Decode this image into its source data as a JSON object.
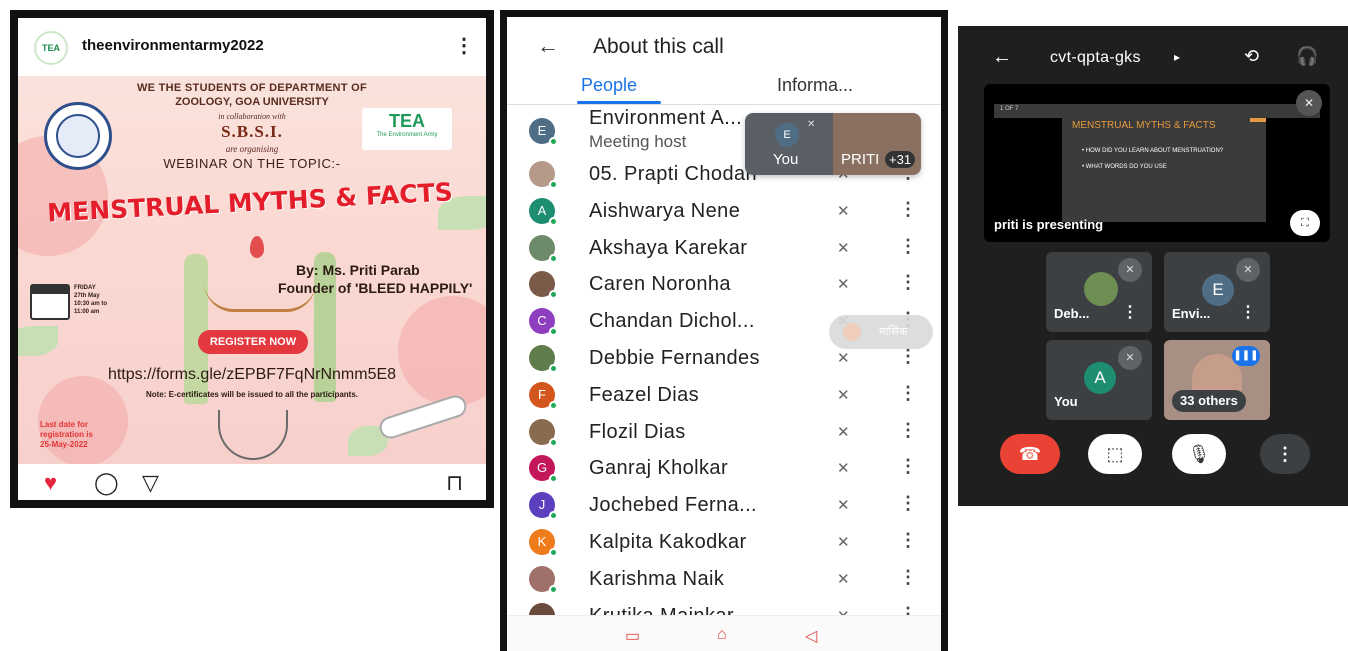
{
  "instagram": {
    "username": "theenvironmentarmy2022",
    "avatar_text": "TEA",
    "more_icon": "⋮",
    "poster": {
      "line1": "WE THE STUDENTS OF DEPARTMENT OF",
      "line2": "ZOOLOGY, GOA UNIVERSITY",
      "collab": "in collaboration with",
      "sbsi": "S.B.S.I.",
      "organising": "are organising",
      "topic": "WEBINAR ON THE TOPIC:-",
      "title": "MENSTRUAL MYTHS & FACTS",
      "tea_logo": "TEA",
      "tea_caption": "The Environment Army",
      "speaker": "By: Ms. Priti Parab",
      "founder": "Founder of  'BLEED HAPPILY'",
      "date_lines": [
        "FRIDAY",
        "27th May",
        "10:30 am to",
        "11:00 am"
      ],
      "register": "REGISTER NOW",
      "url": "https://forms.gle/zEPBF7FqNrNnmm5E8",
      "note": "Note: E-certificates will be issued to all the participants.",
      "last_date": [
        "Last date for",
        "registration is",
        "25-May-2022"
      ]
    }
  },
  "call": {
    "title": "About this call",
    "back_icon": "←",
    "tabs": [
      "People",
      "Informa..."
    ],
    "host": {
      "name": "Environment A...",
      "role": "Meeting host",
      "initial": "E",
      "color": "#4f6e86"
    },
    "pip": {
      "you_initial": "E",
      "you_label": "You",
      "other_label": "PRITI",
      "count": "+31"
    },
    "toast_text": "मासिक",
    "participants": [
      {
        "name": "05. Prapti Chodan",
        "initial": "",
        "color": "#b59a8a",
        "photo": true
      },
      {
        "name": "Aishwarya Nene",
        "initial": "A",
        "color": "#1e8e72"
      },
      {
        "name": "Akshaya Karekar",
        "initial": "",
        "color": "#6d8a6a",
        "photo": true
      },
      {
        "name": "Caren Noronha",
        "initial": "",
        "color": "#7a5a48",
        "photo": true
      },
      {
        "name": "Chandan Dichol...",
        "initial": "C",
        "color": "#8e3fbf"
      },
      {
        "name": "Debbie Fernandes",
        "initial": "",
        "color": "#5e7d4a",
        "photo": true
      },
      {
        "name": "Feazel Dias",
        "initial": "F",
        "color": "#d4561f"
      },
      {
        "name": "Flozil Dias",
        "initial": "",
        "color": "#8b6b4f",
        "photo": true
      },
      {
        "name": "Ganraj Kholkar",
        "initial": "G",
        "color": "#c2185b"
      },
      {
        "name": "Jochebed Ferna...",
        "initial": "J",
        "color": "#5b3fbf"
      },
      {
        "name": "Kalpita Kakodkar",
        "initial": "K",
        "color": "#ef7c1a"
      },
      {
        "name": "Karishma Naik",
        "initial": "",
        "color": "#a0706a",
        "photo": true
      },
      {
        "name": "Krutika Mainkar",
        "initial": "",
        "color": "#6a4a3a",
        "photo": true
      }
    ],
    "mic_off_icon": "🎙̸",
    "kebab_icon": "⋮",
    "nav": [
      "▭",
      "⌂",
      "◁"
    ]
  },
  "meet": {
    "back_icon": "←",
    "meeting_code": "cvt-qpta-gks",
    "caret": "▸",
    "switch_icon": "⟲",
    "audio_icon": "🎧",
    "slide": {
      "bar_text": "1 OF 7",
      "title": "MENSTRUAL MYTHS & FACTS",
      "bullet1": "• HOW DID YOU LEARN ABOUT MENSTRUATION?",
      "bullet2": "• WHAT WORDS DO YOU USE"
    },
    "presenting": "priti is presenting",
    "tiles": [
      {
        "label": "Deb...",
        "initial": "",
        "color": "#6f8e54"
      },
      {
        "label": "Envi...",
        "initial": "E",
        "color": "#4f6e86"
      },
      {
        "label": "You",
        "initial": "A",
        "color": "#1e8e72"
      },
      {
        "label": "33 others",
        "initial": "",
        "color": "#a78f83"
      }
    ],
    "controls": {
      "end": "☎",
      "cam": "⬚",
      "mic": "🎙",
      "more": "⋮"
    },
    "colors": {
      "end": "#ea4335",
      "accent": "#1a73e8"
    }
  }
}
